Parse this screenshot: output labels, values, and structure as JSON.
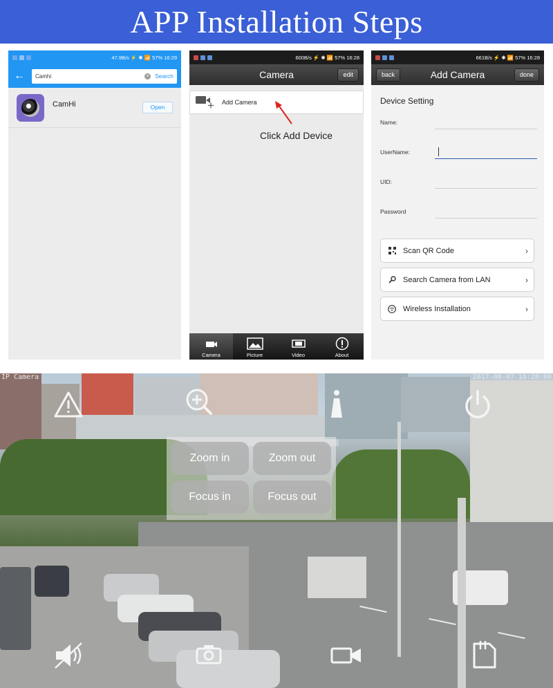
{
  "banner": {
    "title": "APP Installation Steps"
  },
  "screen1": {
    "status": "47.9B/s  ⚡ ✱ 📶 57%  16:29",
    "search_value": "Camhi",
    "search_button": "Search",
    "result": {
      "name": "CamHi",
      "open_label": "Open"
    }
  },
  "screen2": {
    "status": "600B/s  ⚡ ✱ 📶 57%  16:28",
    "title": "Camera",
    "edit_label": "edit",
    "add_camera_label": "Add Camera",
    "hint": "Click Add Device",
    "tabs": [
      {
        "label": "Camera",
        "icon": "camera-icon"
      },
      {
        "label": "Picture",
        "icon": "picture-icon"
      },
      {
        "label": "Video",
        "icon": "video-icon"
      },
      {
        "label": "About",
        "icon": "info-icon"
      }
    ]
  },
  "screen3": {
    "status": "661B/s  ⚡ ✱ 📶 57%  16:28",
    "back_label": "back",
    "title": "Add Camera",
    "done_label": "done",
    "section_title": "Device Setting",
    "fields": [
      {
        "label": "Name:"
      },
      {
        "label": "UserName:"
      },
      {
        "label": "UID:"
      },
      {
        "label": "Password"
      }
    ],
    "options": [
      {
        "label": "Scan QR Code",
        "icon": "qr-icon"
      },
      {
        "label": "Search Camera from LAN",
        "icon": "search-icon"
      },
      {
        "label": "Wireless Installation",
        "icon": "wifi-icon"
      }
    ]
  },
  "live_view": {
    "camera_name": "IP Camera",
    "timestamp": "2017-08-07 16:28:00",
    "ptz": {
      "zoom_in": "Zoom in",
      "zoom_out": "Zoom out",
      "focus_in": "Focus in",
      "focus_out": "Focus out"
    },
    "top_icons": [
      "warning-icon",
      "zoom-plus-icon",
      "info-icon",
      "power-icon"
    ],
    "bottom_icons": [
      "speaker-icon",
      "snapshot-icon",
      "record-icon",
      "sd-card-icon"
    ]
  },
  "colors": {
    "banner": "#3a5fd6",
    "android_blue": "#2196f3",
    "dark_nav": "#3a3a3a",
    "hint_arrow": "#e02020"
  }
}
